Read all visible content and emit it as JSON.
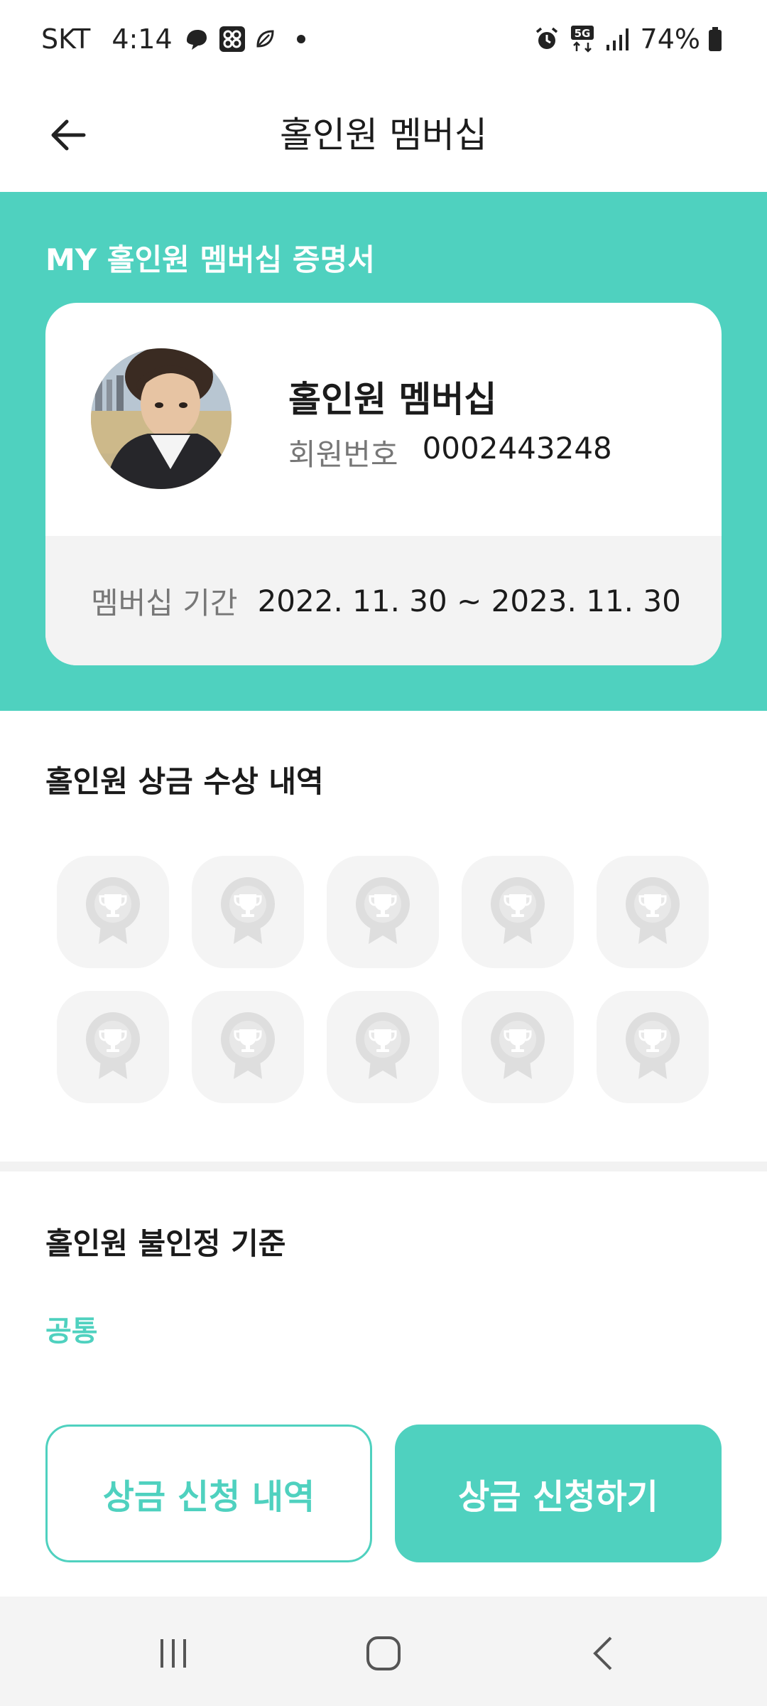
{
  "status_bar": {
    "carrier": "SKT",
    "time": "4:14",
    "battery": "74%",
    "network": "5G",
    "icons": [
      "thread-icon",
      "app-icon",
      "leaf-icon",
      "dot-icon",
      "alarm-icon",
      "5g-icon",
      "signal-icon",
      "battery-icon"
    ]
  },
  "header": {
    "title": "홀인원 멤버십",
    "back_icon": "arrow-left-icon"
  },
  "membership": {
    "section_title": "MY 홀인원 멤버십 증명서",
    "card_name": "홀인원 멤버십",
    "member_label": "회원번호",
    "member_number": "0002443248",
    "period_label": "멤버십 기간",
    "period_value": "2022. 11. 30 ~ 2023. 11. 30"
  },
  "awards": {
    "title": "홀인원 상금 수상 내역",
    "tile_icon": "trophy-badge-icon",
    "tiles": [
      {
        "earned": false
      },
      {
        "earned": false
      },
      {
        "earned": false
      },
      {
        "earned": false
      },
      {
        "earned": false
      },
      {
        "earned": false
      },
      {
        "earned": false
      },
      {
        "earned": false
      },
      {
        "earned": false
      },
      {
        "earned": false
      }
    ]
  },
  "criteria": {
    "title": "홀인원 불인정 기준",
    "subtitle": "공통"
  },
  "buttons": {
    "history": "상금 신청 내역",
    "apply": "상금 신청하기"
  },
  "colors": {
    "accent": "#4fd1bf",
    "tile_bg": "#f4f4f4",
    "tile_icon": "#dedede",
    "nav_bg": "#f4f4f4"
  },
  "nav": {
    "icons": [
      "recent-apps-icon",
      "home-icon",
      "back-icon"
    ]
  }
}
